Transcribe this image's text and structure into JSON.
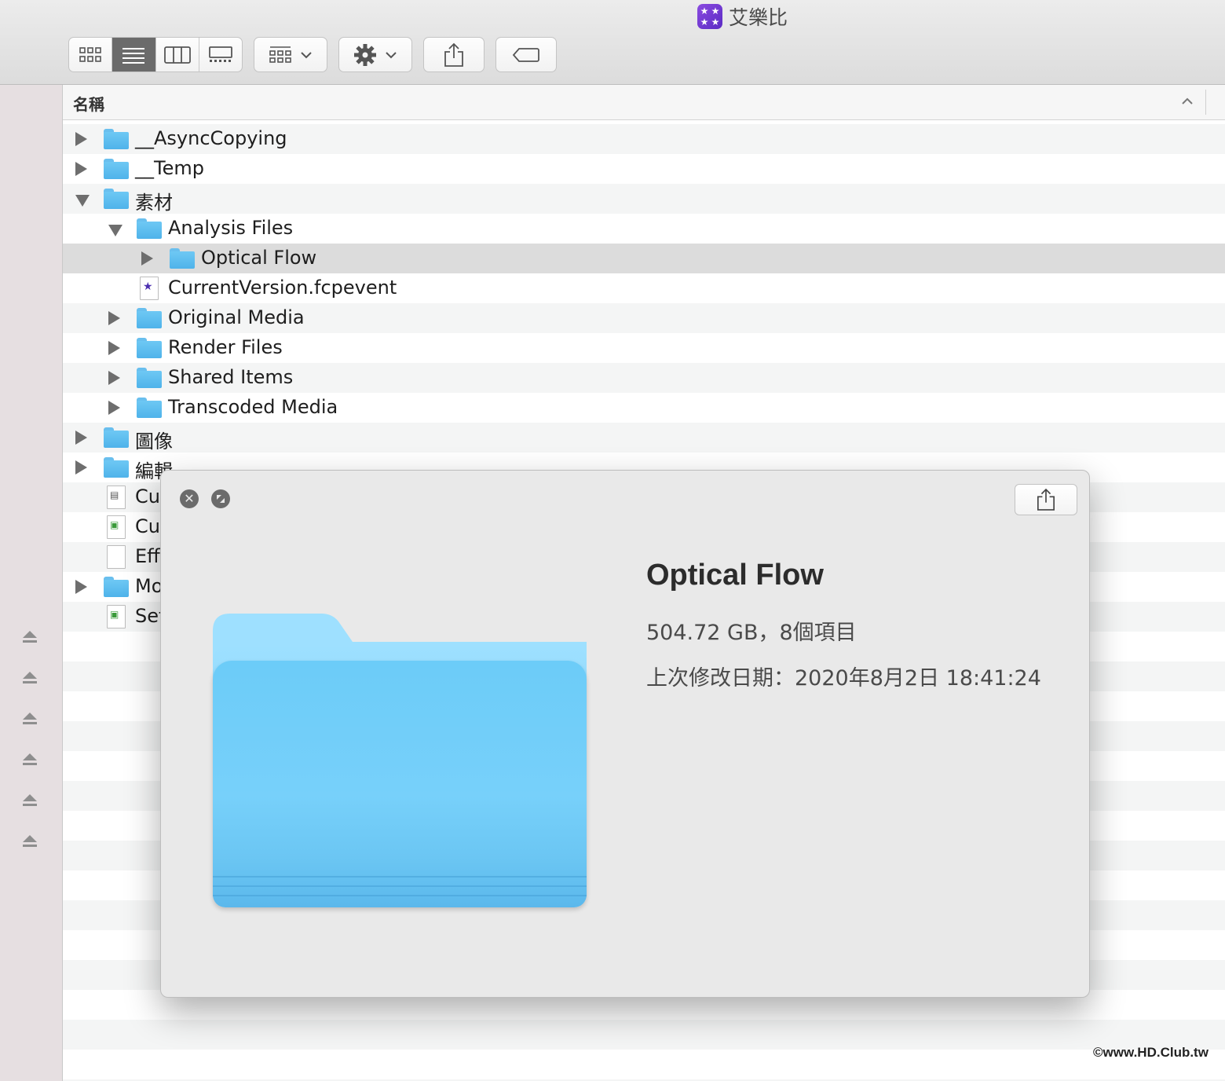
{
  "window": {
    "title": "艾樂比",
    "app_icon": "app-badge-icon"
  },
  "toolbar": {
    "view_modes": [
      {
        "name": "icon-view",
        "icon": "grid-icon"
      },
      {
        "name": "list-view",
        "icon": "list-icon",
        "active": true
      },
      {
        "name": "column-view",
        "icon": "columns-icon"
      },
      {
        "name": "gallery-view",
        "icon": "gallery-icon"
      }
    ],
    "group_by_icon": "group-grid-icon",
    "action_icon": "gear-icon",
    "share_icon": "share-icon",
    "tag_icon": "tag-icon"
  },
  "header": {
    "name_column": "名稱"
  },
  "rows": [
    {
      "label": "__AsyncCopying",
      "depth": 0,
      "disclosure": "closed",
      "icon": "folder"
    },
    {
      "label": "__Temp",
      "depth": 0,
      "disclosure": "closed",
      "icon": "folder"
    },
    {
      "label": "素材",
      "depth": 0,
      "disclosure": "open",
      "icon": "folder"
    },
    {
      "label": "Analysis Files",
      "depth": 1,
      "disclosure": "open",
      "icon": "folder"
    },
    {
      "label": "Optical Flow",
      "depth": 2,
      "disclosure": "closed",
      "icon": "folder",
      "selected": true
    },
    {
      "label": "CurrentVersion.fcpevent",
      "depth": 1,
      "disclosure": "none",
      "icon": "fcpevent"
    },
    {
      "label": "Original Media",
      "depth": 1,
      "disclosure": "closed",
      "icon": "folder"
    },
    {
      "label": "Render Files",
      "depth": 1,
      "disclosure": "closed",
      "icon": "folder"
    },
    {
      "label": "Shared Items",
      "depth": 1,
      "disclosure": "closed",
      "icon": "folder"
    },
    {
      "label": "Transcoded Media",
      "depth": 1,
      "disclosure": "closed",
      "icon": "folder"
    },
    {
      "label": "圖像",
      "depth": 0,
      "disclosure": "closed",
      "icon": "folder"
    },
    {
      "label": "編輯",
      "depth": 0,
      "disclosure": "closed",
      "icon": "folder"
    },
    {
      "label": "Cu",
      "depth": 0,
      "disclosure": "none",
      "icon": "clapper"
    },
    {
      "label": "Cu",
      "depth": 0,
      "disclosure": "none",
      "icon": "doc-color"
    },
    {
      "label": "Eff",
      "depth": 0,
      "disclosure": "none",
      "icon": "blank"
    },
    {
      "label": "Mo",
      "depth": 0,
      "disclosure": "closed",
      "icon": "folder"
    },
    {
      "label": "Set",
      "depth": 0,
      "disclosure": "none",
      "icon": "doc-color"
    }
  ],
  "sidebar": {
    "eject_icons": 6
  },
  "quicklook": {
    "title": "Optical Flow",
    "size_line": "504.72 GB，8個項目",
    "modified_line": "上次修改日期：2020年8月2日 18:41:24",
    "close_icon": "close-icon",
    "fullscreen_icon": "fullscreen-icon",
    "share_icon": "share-icon"
  },
  "watermark": "©www.HD.Club.tw",
  "colors": {
    "folder_blue": "#6ccaf7",
    "selection": "#dcdcdc",
    "sidebar": "#e6dfe1"
  }
}
